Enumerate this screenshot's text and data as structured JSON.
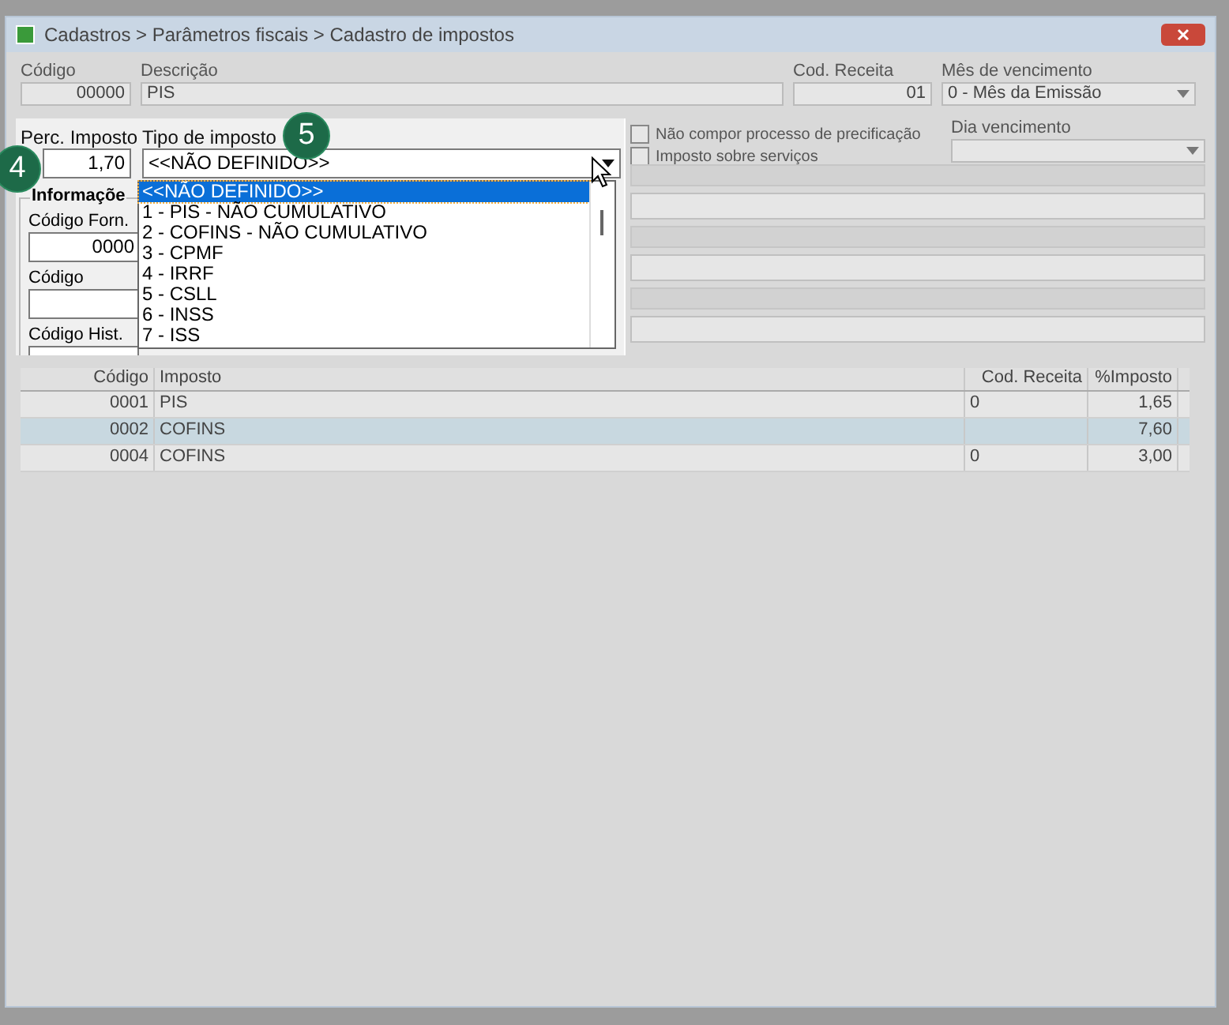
{
  "window": {
    "title": "Cadastros > Parâmetros fiscais > Cadastro de impostos"
  },
  "top_fields": [
    {
      "kind": "number",
      "label": "Código",
      "value": "00000"
    },
    {
      "kind": "text",
      "label": "Descrição",
      "value": "PIS"
    },
    {
      "kind": "number",
      "label": "Cod. Receita",
      "value": "01"
    },
    {
      "kind": "select",
      "label": "Mês de vencimento",
      "value": "0 - Mês da Emissão"
    }
  ],
  "checkboxes": [
    {
      "label": "Não compor processo de precificação",
      "checked": false
    },
    {
      "label": "Imposto sobre serviços",
      "checked": false
    }
  ],
  "dia_vencimento": {
    "label": "Dia vencimento"
  },
  "focus": {
    "perc_imposto": {
      "label": "Perc. Imposto",
      "value": "1,70"
    },
    "tipo_imposto": {
      "label": "Tipo de imposto",
      "value": "<<NÃO DEFINIDO>>",
      "expanded": true,
      "options": [
        {
          "label": "<<NÃO DEFINIDO>>",
          "selected": true
        },
        {
          "label": "1 - PIS - NÃO CUMULATIVO",
          "selected": false
        },
        {
          "label": "2 - COFINS - NÃO CUMULATIVO",
          "selected": false
        },
        {
          "label": "3 - CPMF",
          "selected": false
        },
        {
          "label": "4 - IRRF",
          "selected": false
        },
        {
          "label": "5 - CSLL",
          "selected": false
        },
        {
          "label": "6 - INSS",
          "selected": false
        },
        {
          "label": "7 - ISS",
          "selected": false
        }
      ]
    },
    "group": {
      "title": "Informaçõe",
      "fields": [
        {
          "label": "Código Forn.",
          "value": "0000"
        },
        {
          "label": "Código"
        },
        {
          "label": "Código Hist."
        }
      ]
    }
  },
  "callouts": [
    "4",
    "5"
  ],
  "table": {
    "columns": [
      "Código",
      "Imposto",
      "Cod. Receita",
      "%Imposto"
    ],
    "rows": [
      {
        "cells": [
          "0001",
          "PIS",
          "0",
          "1,65"
        ],
        "selected": false
      },
      {
        "cells": [
          "0002",
          "COFINS",
          "",
          "7,60"
        ],
        "selected": true
      },
      {
        "cells": [
          "0004",
          "COFINS",
          "0",
          "3,00"
        ],
        "selected": false
      }
    ]
  }
}
